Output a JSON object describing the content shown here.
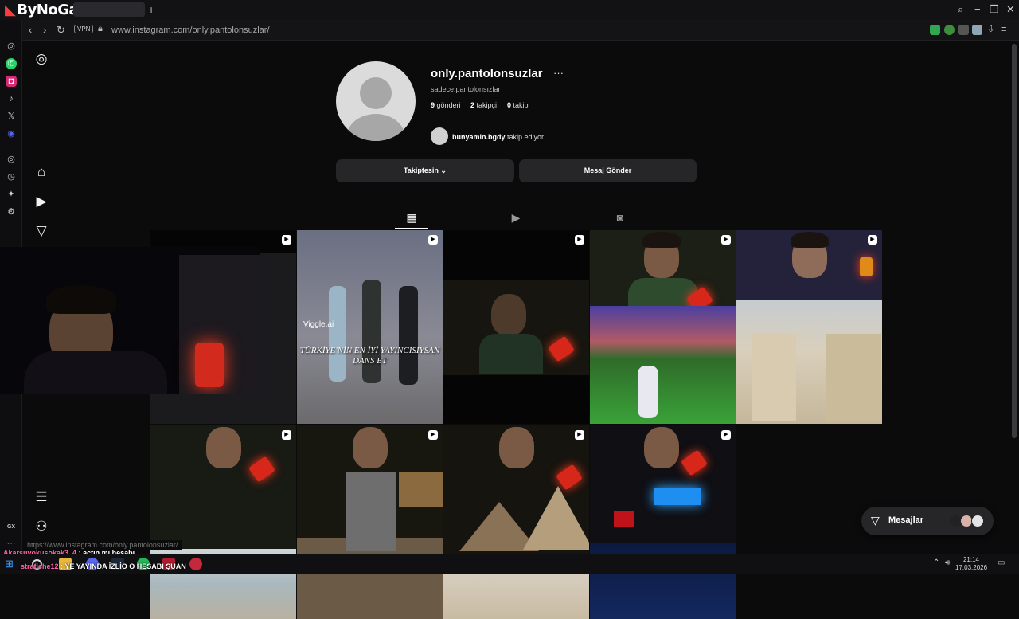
{
  "browser": {
    "brand": "ByNoGame",
    "new_tab": "+",
    "url": "www.instagram.com/only.pantolonsuzlar/",
    "vpn_label": "VPN",
    "status_url": "https://www.instagram.com/only.pantolonsuzlar/"
  },
  "profile": {
    "username": "only.pantolonsuzlar",
    "more": "···",
    "full_name": "sadece.pantolonsızlar",
    "posts_count": "9",
    "posts_label": "gönderi",
    "followers_count": "2",
    "followers_label": "takipçi",
    "following_count": "0",
    "following_label": "takip",
    "mutual_user": "bunyamin.bgdy",
    "mutual_suffix": "takip ediyor",
    "follow_button": "Takiptesin",
    "message_button": "Mesaj Gönder"
  },
  "grid": {
    "dance_caption": "TÜRKİYE'NİN EN İYİ YAYINCISIYSAN DANS ET",
    "viggle_label": "Viggle.ai"
  },
  "messages": {
    "label": "Mesajlar"
  },
  "chat": {
    "line1_user": "Akarsuyokusokak3_4",
    "line1_text": ": açtın mı hesabı",
    "line2_user": "strafiche12",
    "line2_text": ": YE YAYINDA İZLİO O HESABI ŞUAN"
  },
  "taskbar": {
    "time": "21:14",
    "date": "17.03.2026"
  },
  "sidebar_bottom": {
    "gx_label": "GX",
    "dots": "···"
  },
  "colors": {
    "background": "#0b0b0c",
    "button": "#262629",
    "accent_red": "#ff3b3b",
    "chat_user": "#ff63a5"
  }
}
